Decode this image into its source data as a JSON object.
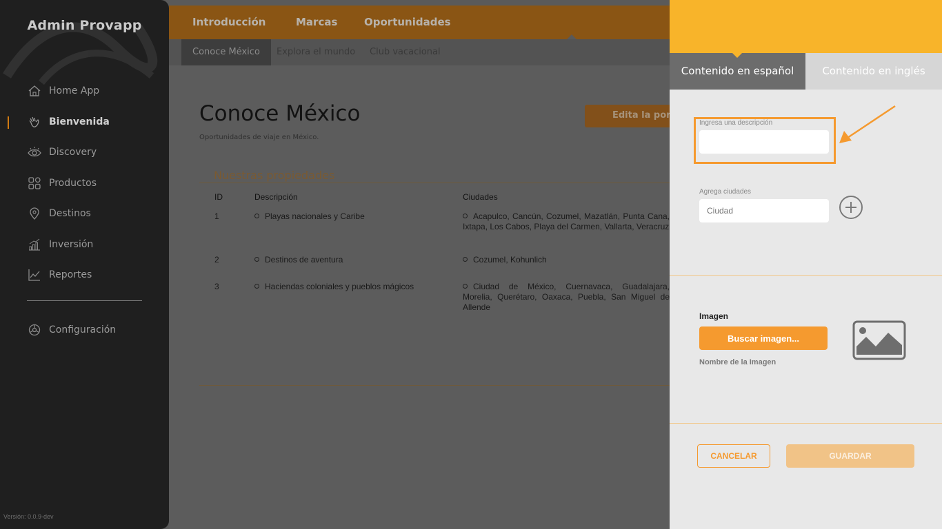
{
  "sidebar": {
    "brand": "Admin Provapp",
    "items": [
      {
        "label": "Home App",
        "icon": "home-icon"
      },
      {
        "label": "Bienvenida",
        "icon": "wave-hand-icon",
        "active": true
      },
      {
        "label": "Discovery",
        "icon": "eye-icon"
      },
      {
        "label": "Productos",
        "icon": "grid-icon"
      },
      {
        "label": "Destinos",
        "icon": "map-pin-icon"
      },
      {
        "label": "Inversión",
        "icon": "bar-chart-icon"
      },
      {
        "label": "Reportes",
        "icon": "line-chart-icon"
      }
    ],
    "settings": {
      "label": "Configuración",
      "icon": "gear-icon"
    },
    "version": "Versión: 0.0.9-dev"
  },
  "topnav": {
    "tabs": [
      "Introducción",
      "Marcas",
      "Oportunidades"
    ],
    "active_tab": "Oportunidades"
  },
  "subnav": {
    "tabs": [
      "Conoce México",
      "Explora el mundo",
      "Club vacacional"
    ],
    "active_tab": "Conoce México"
  },
  "main": {
    "title": "Conoce México",
    "subtitle": "Oportunidades de viaje en México.",
    "edit_button": "Edita la porta",
    "section_title": "Nuestras propiedades",
    "table": {
      "headers": [
        "ID",
        "Descripción",
        "Ciudades"
      ],
      "rows": [
        {
          "id": "1",
          "description": "Playas nacionales y Caribe",
          "cities": "Acapulco, Cancún, Cozumel, Mazatlán, Punta Cana, Ixtapa, Los Cabos, Playa del Carmen, Vallarta, Veracruz"
        },
        {
          "id": "2",
          "description": "Destinos de aventura",
          "cities": "Cozumel, Kohunlich"
        },
        {
          "id": "3",
          "description": "Haciendas coloniales y pueblos mágicos",
          "cities": "Ciudad de México, Cuernavaca, Guadalajara, Morelia, Querétaro, Oaxaca, Puebla, San Miguel de Allende"
        }
      ]
    }
  },
  "panel": {
    "tabs": [
      "Contenido en español",
      "Contenido en inglés"
    ],
    "active_tab": "Contenido en español",
    "description_label": "Ingresa una descripción",
    "description_value": "",
    "cities_label": "Agrega ciudades",
    "cities_placeholder": "Ciudad",
    "image_title": "Imagen",
    "search_image_button": "Buscar imagen...",
    "image_name": "Nombre de la Imagen",
    "cancel_button": "CANCELAR",
    "save_button": "GUARDAR"
  },
  "colors": {
    "accent": "#f59a2f",
    "header": "#f8b42a",
    "sidebar": "#1f1f1f"
  }
}
